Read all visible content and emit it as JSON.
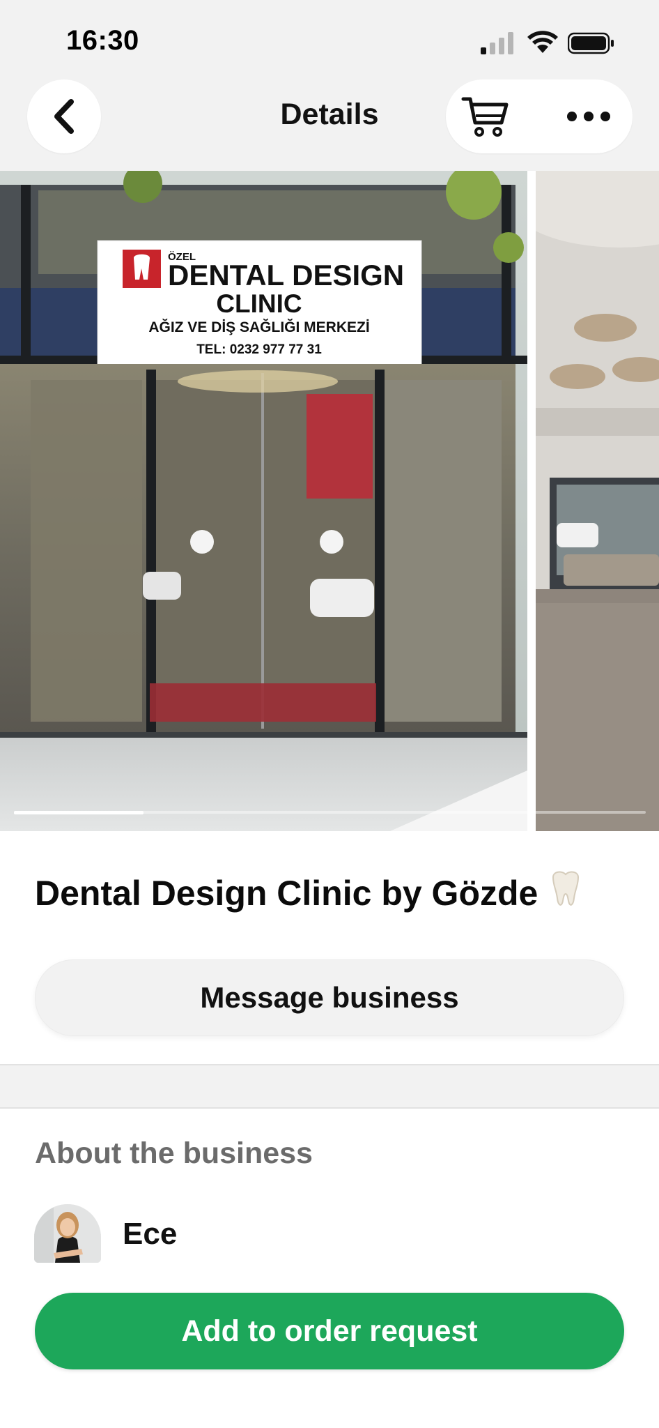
{
  "status_bar": {
    "time": "16:30"
  },
  "header": {
    "title": "Details"
  },
  "gallery": {
    "photo_count": 2,
    "active_index": 1,
    "sign": {
      "small_text": "ÖZEL",
      "line1": "DENTAL DESIGN",
      "line2": "CLINIC",
      "line3": "AĞIZ VE DİŞ SAĞLIĞI MERKEZİ",
      "line4": "TEL: 0232 977 77 31"
    }
  },
  "business": {
    "name": "Dental Design Clinic by Gözde",
    "message_label": "Message business"
  },
  "about": {
    "heading": "About the business",
    "owner_name": "Ece"
  },
  "cta": {
    "label": "Add to order request"
  },
  "colors": {
    "accent": "#1da75a",
    "background": "#f2f2f2",
    "muted_text": "#6b6b6b"
  },
  "icons": [
    "back-arrow-icon",
    "cart-icon",
    "more-icon",
    "tooth-emoji-icon",
    "signal-icon",
    "wifi-icon",
    "battery-icon"
  ]
}
